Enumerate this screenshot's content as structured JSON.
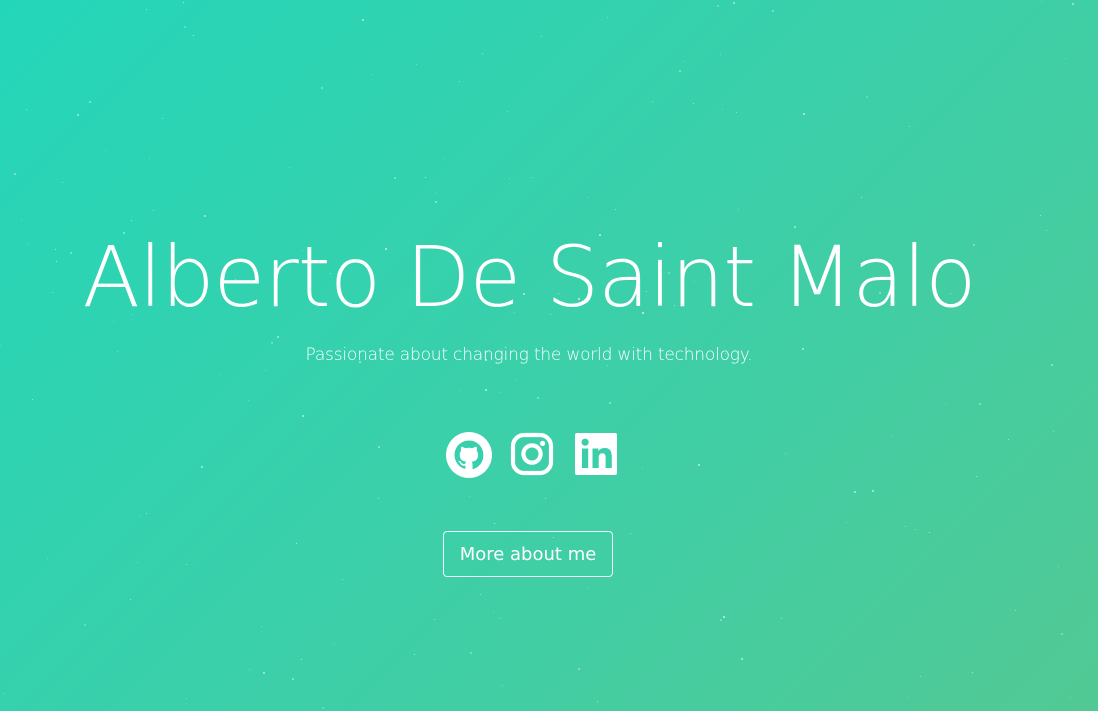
{
  "hero": {
    "title": "Alberto De Saint Malo",
    "subtitle": "Passionate about changing the world with technology.",
    "background_colors": [
      "#24d6b9",
      "#3dcfa8",
      "#52c994"
    ],
    "text_color": "#ffffff"
  },
  "social": {
    "items": [
      {
        "name": "GitHub",
        "icon": "github-icon"
      },
      {
        "name": "Instagram",
        "icon": "instagram-icon"
      },
      {
        "name": "LinkedIn",
        "icon": "linkedin-icon"
      }
    ]
  },
  "cta": {
    "label": "More about me"
  }
}
